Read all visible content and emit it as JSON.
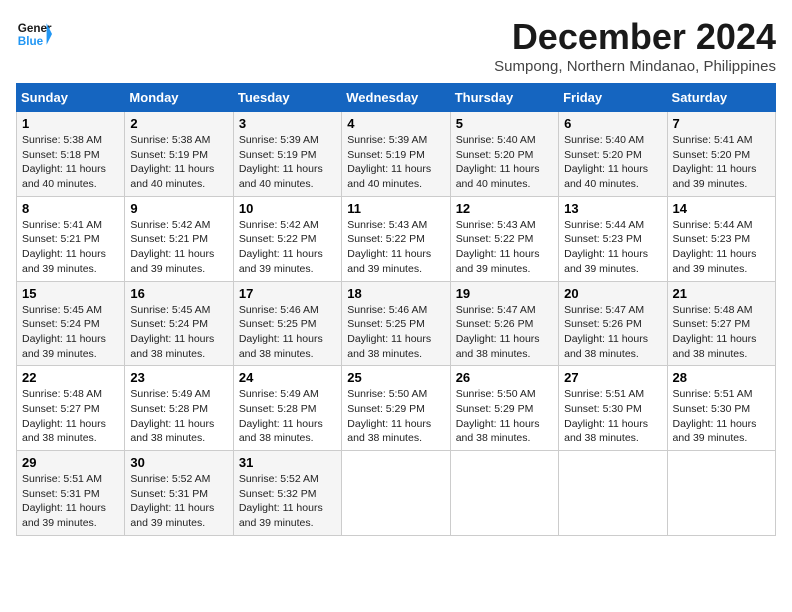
{
  "header": {
    "logo_line1": "General",
    "logo_line2": "Blue",
    "month_title": "December 2024",
    "location": "Sumpong, Northern Mindanao, Philippines"
  },
  "weekdays": [
    "Sunday",
    "Monday",
    "Tuesday",
    "Wednesday",
    "Thursday",
    "Friday",
    "Saturday"
  ],
  "weeks": [
    [
      {
        "day": "1",
        "sunrise": "5:38 AM",
        "sunset": "5:18 PM",
        "daylight": "11 hours and 40 minutes."
      },
      {
        "day": "2",
        "sunrise": "5:38 AM",
        "sunset": "5:19 PM",
        "daylight": "11 hours and 40 minutes."
      },
      {
        "day": "3",
        "sunrise": "5:39 AM",
        "sunset": "5:19 PM",
        "daylight": "11 hours and 40 minutes."
      },
      {
        "day": "4",
        "sunrise": "5:39 AM",
        "sunset": "5:19 PM",
        "daylight": "11 hours and 40 minutes."
      },
      {
        "day": "5",
        "sunrise": "5:40 AM",
        "sunset": "5:20 PM",
        "daylight": "11 hours and 40 minutes."
      },
      {
        "day": "6",
        "sunrise": "5:40 AM",
        "sunset": "5:20 PM",
        "daylight": "11 hours and 40 minutes."
      },
      {
        "day": "7",
        "sunrise": "5:41 AM",
        "sunset": "5:20 PM",
        "daylight": "11 hours and 39 minutes."
      }
    ],
    [
      {
        "day": "8",
        "sunrise": "5:41 AM",
        "sunset": "5:21 PM",
        "daylight": "11 hours and 39 minutes."
      },
      {
        "day": "9",
        "sunrise": "5:42 AM",
        "sunset": "5:21 PM",
        "daylight": "11 hours and 39 minutes."
      },
      {
        "day": "10",
        "sunrise": "5:42 AM",
        "sunset": "5:22 PM",
        "daylight": "11 hours and 39 minutes."
      },
      {
        "day": "11",
        "sunrise": "5:43 AM",
        "sunset": "5:22 PM",
        "daylight": "11 hours and 39 minutes."
      },
      {
        "day": "12",
        "sunrise": "5:43 AM",
        "sunset": "5:22 PM",
        "daylight": "11 hours and 39 minutes."
      },
      {
        "day": "13",
        "sunrise": "5:44 AM",
        "sunset": "5:23 PM",
        "daylight": "11 hours and 39 minutes."
      },
      {
        "day": "14",
        "sunrise": "5:44 AM",
        "sunset": "5:23 PM",
        "daylight": "11 hours and 39 minutes."
      }
    ],
    [
      {
        "day": "15",
        "sunrise": "5:45 AM",
        "sunset": "5:24 PM",
        "daylight": "11 hours and 39 minutes."
      },
      {
        "day": "16",
        "sunrise": "5:45 AM",
        "sunset": "5:24 PM",
        "daylight": "11 hours and 38 minutes."
      },
      {
        "day": "17",
        "sunrise": "5:46 AM",
        "sunset": "5:25 PM",
        "daylight": "11 hours and 38 minutes."
      },
      {
        "day": "18",
        "sunrise": "5:46 AM",
        "sunset": "5:25 PM",
        "daylight": "11 hours and 38 minutes."
      },
      {
        "day": "19",
        "sunrise": "5:47 AM",
        "sunset": "5:26 PM",
        "daylight": "11 hours and 38 minutes."
      },
      {
        "day": "20",
        "sunrise": "5:47 AM",
        "sunset": "5:26 PM",
        "daylight": "11 hours and 38 minutes."
      },
      {
        "day": "21",
        "sunrise": "5:48 AM",
        "sunset": "5:27 PM",
        "daylight": "11 hours and 38 minutes."
      }
    ],
    [
      {
        "day": "22",
        "sunrise": "5:48 AM",
        "sunset": "5:27 PM",
        "daylight": "11 hours and 38 minutes."
      },
      {
        "day": "23",
        "sunrise": "5:49 AM",
        "sunset": "5:28 PM",
        "daylight": "11 hours and 38 minutes."
      },
      {
        "day": "24",
        "sunrise": "5:49 AM",
        "sunset": "5:28 PM",
        "daylight": "11 hours and 38 minutes."
      },
      {
        "day": "25",
        "sunrise": "5:50 AM",
        "sunset": "5:29 PM",
        "daylight": "11 hours and 38 minutes."
      },
      {
        "day": "26",
        "sunrise": "5:50 AM",
        "sunset": "5:29 PM",
        "daylight": "11 hours and 38 minutes."
      },
      {
        "day": "27",
        "sunrise": "5:51 AM",
        "sunset": "5:30 PM",
        "daylight": "11 hours and 38 minutes."
      },
      {
        "day": "28",
        "sunrise": "5:51 AM",
        "sunset": "5:30 PM",
        "daylight": "11 hours and 39 minutes."
      }
    ],
    [
      {
        "day": "29",
        "sunrise": "5:51 AM",
        "sunset": "5:31 PM",
        "daylight": "11 hours and 39 minutes."
      },
      {
        "day": "30",
        "sunrise": "5:52 AM",
        "sunset": "5:31 PM",
        "daylight": "11 hours and 39 minutes."
      },
      {
        "day": "31",
        "sunrise": "5:52 AM",
        "sunset": "5:32 PM",
        "daylight": "11 hours and 39 minutes."
      },
      null,
      null,
      null,
      null
    ]
  ]
}
